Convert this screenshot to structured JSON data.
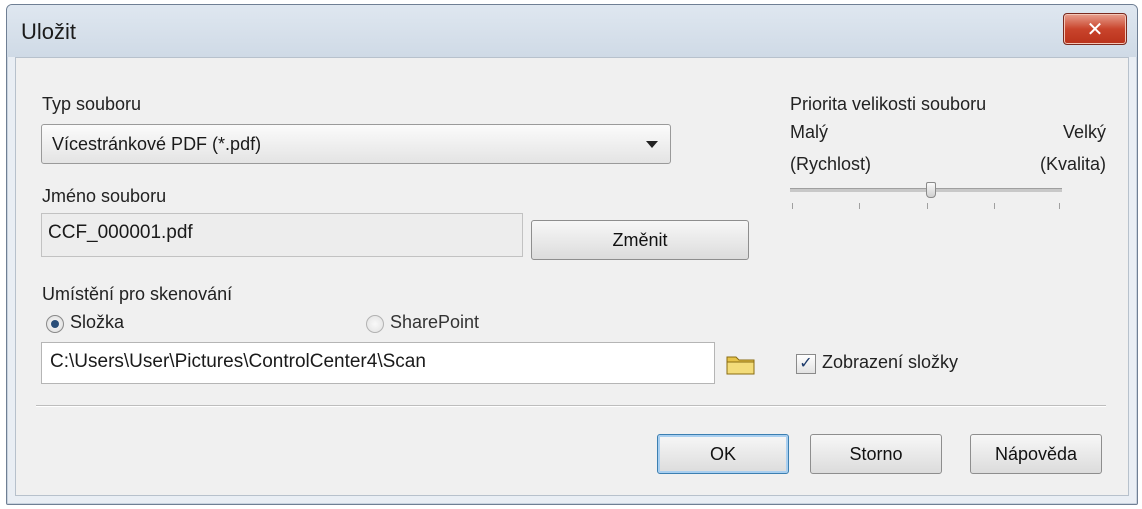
{
  "window": {
    "title": "Uložit",
    "close_label": "✕"
  },
  "file_type": {
    "label": "Typ souboru",
    "selected": "Vícestránkové PDF (*.pdf)"
  },
  "file_name": {
    "label": "Jméno souboru",
    "value": "CCF_000001.pdf",
    "change_button": "Změnit"
  },
  "size_priority": {
    "label": "Priorita velikosti souboru",
    "min_label": "Malý",
    "min_sub": "(Rychlost)",
    "max_label": "Velký",
    "max_sub": "(Kvalita)",
    "tick_count": 5
  },
  "scan_location": {
    "label": "Umístění pro skenování",
    "options": [
      {
        "label": "Složka",
        "checked": true
      },
      {
        "label": "SharePoint",
        "checked": false
      }
    ],
    "path": "C:\\Users\\User\\Pictures\\ControlCenter4\\Scan",
    "show_folder_label": "Zobrazení složky",
    "show_folder_checked": true
  },
  "buttons": {
    "ok": "OK",
    "cancel": "Storno",
    "help": "Nápověda"
  },
  "colors": {
    "close_button": "#c9442c",
    "default_button_border": "#3c7fb1"
  }
}
